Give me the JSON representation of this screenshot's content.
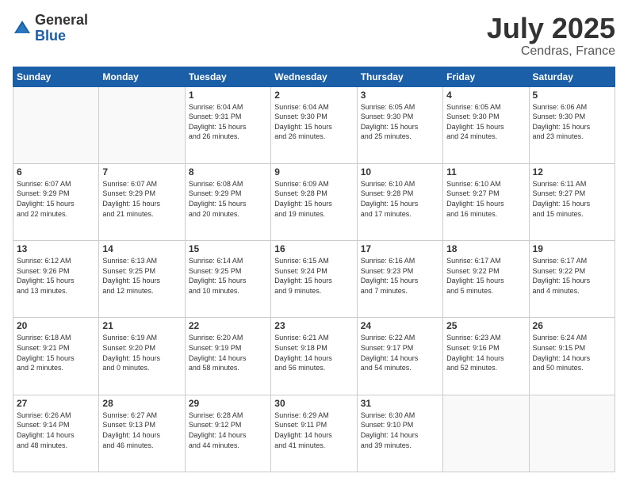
{
  "logo": {
    "general": "General",
    "blue": "Blue"
  },
  "title": "July 2025",
  "location": "Cendras, France",
  "days_header": [
    "Sunday",
    "Monday",
    "Tuesday",
    "Wednesday",
    "Thursday",
    "Friday",
    "Saturday"
  ],
  "weeks": [
    [
      {
        "num": "",
        "info": ""
      },
      {
        "num": "",
        "info": ""
      },
      {
        "num": "1",
        "info": "Sunrise: 6:04 AM\nSunset: 9:31 PM\nDaylight: 15 hours\nand 26 minutes."
      },
      {
        "num": "2",
        "info": "Sunrise: 6:04 AM\nSunset: 9:30 PM\nDaylight: 15 hours\nand 26 minutes."
      },
      {
        "num": "3",
        "info": "Sunrise: 6:05 AM\nSunset: 9:30 PM\nDaylight: 15 hours\nand 25 minutes."
      },
      {
        "num": "4",
        "info": "Sunrise: 6:05 AM\nSunset: 9:30 PM\nDaylight: 15 hours\nand 24 minutes."
      },
      {
        "num": "5",
        "info": "Sunrise: 6:06 AM\nSunset: 9:30 PM\nDaylight: 15 hours\nand 23 minutes."
      }
    ],
    [
      {
        "num": "6",
        "info": "Sunrise: 6:07 AM\nSunset: 9:29 PM\nDaylight: 15 hours\nand 22 minutes."
      },
      {
        "num": "7",
        "info": "Sunrise: 6:07 AM\nSunset: 9:29 PM\nDaylight: 15 hours\nand 21 minutes."
      },
      {
        "num": "8",
        "info": "Sunrise: 6:08 AM\nSunset: 9:29 PM\nDaylight: 15 hours\nand 20 minutes."
      },
      {
        "num": "9",
        "info": "Sunrise: 6:09 AM\nSunset: 9:28 PM\nDaylight: 15 hours\nand 19 minutes."
      },
      {
        "num": "10",
        "info": "Sunrise: 6:10 AM\nSunset: 9:28 PM\nDaylight: 15 hours\nand 17 minutes."
      },
      {
        "num": "11",
        "info": "Sunrise: 6:10 AM\nSunset: 9:27 PM\nDaylight: 15 hours\nand 16 minutes."
      },
      {
        "num": "12",
        "info": "Sunrise: 6:11 AM\nSunset: 9:27 PM\nDaylight: 15 hours\nand 15 minutes."
      }
    ],
    [
      {
        "num": "13",
        "info": "Sunrise: 6:12 AM\nSunset: 9:26 PM\nDaylight: 15 hours\nand 13 minutes."
      },
      {
        "num": "14",
        "info": "Sunrise: 6:13 AM\nSunset: 9:25 PM\nDaylight: 15 hours\nand 12 minutes."
      },
      {
        "num": "15",
        "info": "Sunrise: 6:14 AM\nSunset: 9:25 PM\nDaylight: 15 hours\nand 10 minutes."
      },
      {
        "num": "16",
        "info": "Sunrise: 6:15 AM\nSunset: 9:24 PM\nDaylight: 15 hours\nand 9 minutes."
      },
      {
        "num": "17",
        "info": "Sunrise: 6:16 AM\nSunset: 9:23 PM\nDaylight: 15 hours\nand 7 minutes."
      },
      {
        "num": "18",
        "info": "Sunrise: 6:17 AM\nSunset: 9:22 PM\nDaylight: 15 hours\nand 5 minutes."
      },
      {
        "num": "19",
        "info": "Sunrise: 6:17 AM\nSunset: 9:22 PM\nDaylight: 15 hours\nand 4 minutes."
      }
    ],
    [
      {
        "num": "20",
        "info": "Sunrise: 6:18 AM\nSunset: 9:21 PM\nDaylight: 15 hours\nand 2 minutes."
      },
      {
        "num": "21",
        "info": "Sunrise: 6:19 AM\nSunset: 9:20 PM\nDaylight: 15 hours\nand 0 minutes."
      },
      {
        "num": "22",
        "info": "Sunrise: 6:20 AM\nSunset: 9:19 PM\nDaylight: 14 hours\nand 58 minutes."
      },
      {
        "num": "23",
        "info": "Sunrise: 6:21 AM\nSunset: 9:18 PM\nDaylight: 14 hours\nand 56 minutes."
      },
      {
        "num": "24",
        "info": "Sunrise: 6:22 AM\nSunset: 9:17 PM\nDaylight: 14 hours\nand 54 minutes."
      },
      {
        "num": "25",
        "info": "Sunrise: 6:23 AM\nSunset: 9:16 PM\nDaylight: 14 hours\nand 52 minutes."
      },
      {
        "num": "26",
        "info": "Sunrise: 6:24 AM\nSunset: 9:15 PM\nDaylight: 14 hours\nand 50 minutes."
      }
    ],
    [
      {
        "num": "27",
        "info": "Sunrise: 6:26 AM\nSunset: 9:14 PM\nDaylight: 14 hours\nand 48 minutes."
      },
      {
        "num": "28",
        "info": "Sunrise: 6:27 AM\nSunset: 9:13 PM\nDaylight: 14 hours\nand 46 minutes."
      },
      {
        "num": "29",
        "info": "Sunrise: 6:28 AM\nSunset: 9:12 PM\nDaylight: 14 hours\nand 44 minutes."
      },
      {
        "num": "30",
        "info": "Sunrise: 6:29 AM\nSunset: 9:11 PM\nDaylight: 14 hours\nand 41 minutes."
      },
      {
        "num": "31",
        "info": "Sunrise: 6:30 AM\nSunset: 9:10 PM\nDaylight: 14 hours\nand 39 minutes."
      },
      {
        "num": "",
        "info": ""
      },
      {
        "num": "",
        "info": ""
      }
    ]
  ]
}
